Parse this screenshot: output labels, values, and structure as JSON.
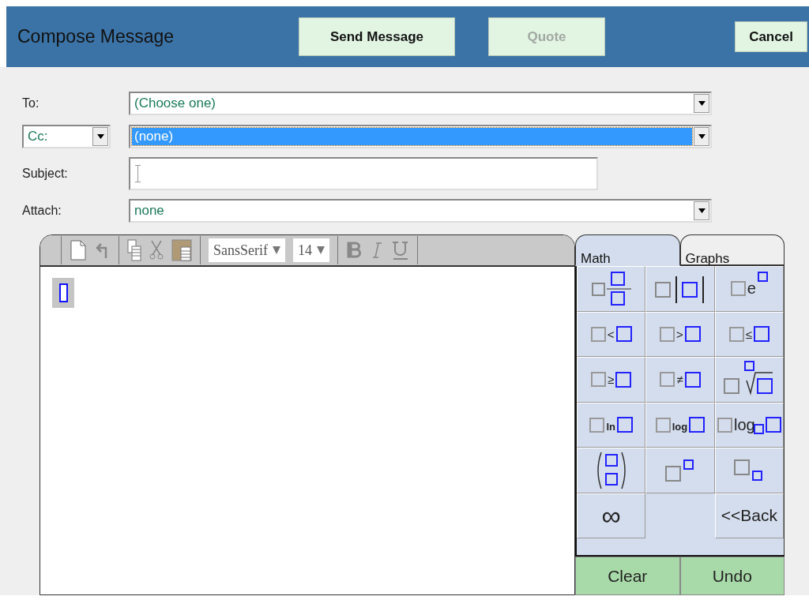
{
  "header": {
    "title": "Compose Message",
    "buttons": [
      {
        "label": "Send Message",
        "disabled": false
      },
      {
        "label": "Quote",
        "disabled": true
      },
      {
        "label": "Cancel",
        "disabled": false
      }
    ]
  },
  "form": {
    "to": {
      "label": "To:",
      "value": "(Choose one)",
      "focused": false
    },
    "cc": {
      "type": "Cc:",
      "value": "(none)",
      "focused": true
    },
    "subject": {
      "label": "Subject:"
    },
    "attach": {
      "label": "Attach:",
      "value": "none",
      "focused": false
    }
  },
  "editor": {
    "toolbar": {
      "font": "SansSerif",
      "size": "14"
    }
  },
  "palette": {
    "tabs": [
      {
        "label": "Math",
        "selected": true
      },
      {
        "label": "Graphs",
        "selected": false
      }
    ],
    "buttons": [
      {
        "kind": "fraction"
      },
      {
        "kind": "abs"
      },
      {
        "kind": "exp",
        "symbol": "e"
      },
      {
        "kind": "relation",
        "symbol": "<"
      },
      {
        "kind": "relation",
        "symbol": ">"
      },
      {
        "kind": "relation",
        "symbol": "≤"
      },
      {
        "kind": "relation",
        "symbol": "≥"
      },
      {
        "kind": "relation",
        "symbol": "≠"
      },
      {
        "kind": "root"
      },
      {
        "kind": "function",
        "symbol": "ln"
      },
      {
        "kind": "function",
        "symbol": "log"
      },
      {
        "kind": "log_base",
        "symbol": "log"
      },
      {
        "kind": "matrix"
      },
      {
        "kind": "power"
      },
      {
        "kind": "subscript"
      },
      {
        "kind": "infinity",
        "symbol": "∞"
      },
      {
        "kind": "back",
        "symbol": "<<Back"
      }
    ],
    "actions": [
      "Clear",
      "Undo"
    ]
  }
}
